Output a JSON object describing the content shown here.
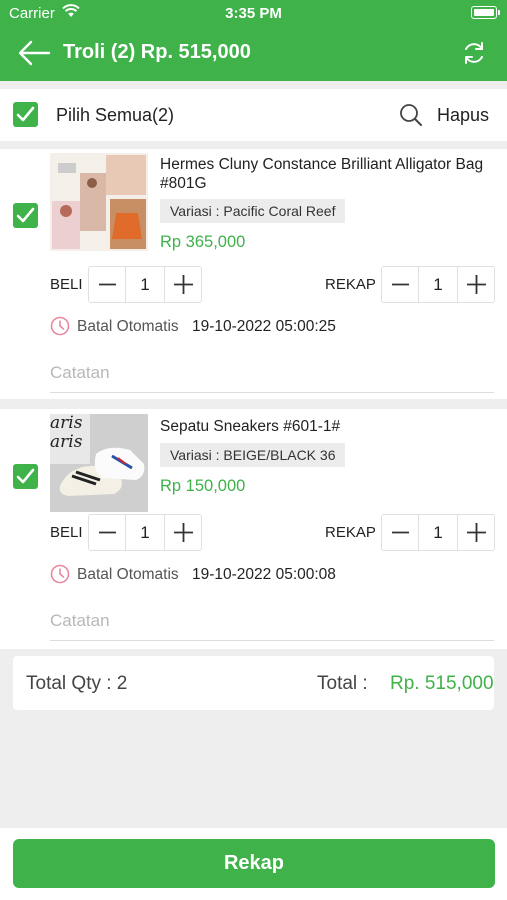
{
  "status": {
    "carrier": "Carrier",
    "time": "3:35 PM"
  },
  "nav": {
    "title": "Troli (2) Rp. 515,000"
  },
  "select_all": {
    "label": "Pilih Semua(2)",
    "delete_label": "Hapus"
  },
  "items": [
    {
      "name": "Hermes Cluny Constance Brilliant Alligator Bag #801G",
      "variant": "Variasi : Pacific Coral Reef",
      "price": "Rp 365,000",
      "buy_label": "BELI",
      "buy_qty": "1",
      "rekap_label": "REKAP",
      "rekap_qty": "1",
      "timer_label": "Batal Otomatis",
      "timer_value": "19-10-2022 05:00:25",
      "note_placeholder": "Catatan",
      "checked": true
    },
    {
      "name": "Sepatu Sneakers #601-1#",
      "variant": "Variasi : BEIGE/BLACK 36",
      "price": "Rp 150,000",
      "buy_label": "BELI",
      "buy_qty": "1",
      "rekap_label": "REKAP",
      "rekap_qty": "1",
      "timer_label": "Batal Otomatis",
      "timer_value": "19-10-2022 05:00:08",
      "note_placeholder": "Catatan",
      "checked": true
    }
  ],
  "thumb_text": {
    "brand_line1": "aris",
    "brand_line2": "aris"
  },
  "totals": {
    "qty": "Total Qty : 2",
    "total_label": "Total :",
    "total_value": "Rp. 515,000"
  },
  "footer": {
    "button_label": "Rekap"
  },
  "colors": {
    "accent": "#3fb24a",
    "timer_icon": "#e98aa0"
  },
  "icons": {
    "back": "arrow-left-icon",
    "refresh": "refresh-icon",
    "search": "search-icon",
    "clock": "clock-icon",
    "check": "check-icon"
  }
}
